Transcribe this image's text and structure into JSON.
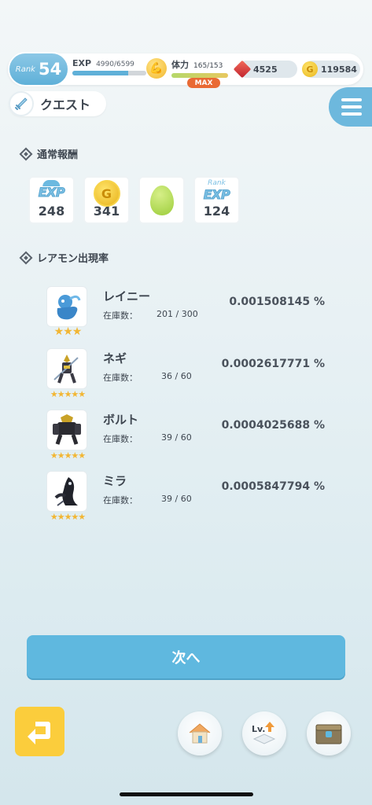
{
  "status": {
    "rank_label": "Rank",
    "rank_value": "54",
    "exp_label": "EXP",
    "exp_value": "4990/6599",
    "exp_progress": 0.756,
    "stamina_label": "体力",
    "stamina_value": "165/153",
    "stamina_progress": 1.0,
    "max_badge": "MAX",
    "gems": "4525",
    "coins": "119584"
  },
  "header": {
    "quest_label": "クエスト"
  },
  "normal_rewards": {
    "title": "通常報酬",
    "items": [
      {
        "icon": "exp-icon",
        "label": "EXP",
        "value": "248"
      },
      {
        "icon": "coin-icon",
        "label": "G",
        "value": "341"
      },
      {
        "icon": "egg-icon",
        "label": "",
        "value": ""
      },
      {
        "icon": "rank-exp-icon",
        "label": "EXP",
        "sublabel": "Rank",
        "value": "124"
      }
    ]
  },
  "rare_monsters": {
    "title": "レアモン出現率",
    "stock_label": "在庫数：",
    "items": [
      {
        "name": "レイニー",
        "stock": "201 / 300",
        "rate": "0.001508145 %",
        "stars": 3,
        "stars_text": "★★★",
        "color": "#4a9ad8"
      },
      {
        "name": "ネギ",
        "stock": "36 / 60",
        "rate": "0.0002617771 %",
        "stars": 5,
        "stars_text": "★★★★★",
        "color": "#3a3a44"
      },
      {
        "name": "ボルト",
        "stock": "39 / 60",
        "rate": "0.0004025688 %",
        "stars": 5,
        "stars_text": "★★★★★",
        "color": "#2a2a30"
      },
      {
        "name": "ミラ",
        "stock": "39 / 60",
        "rate": "0.0005847794 %",
        "stars": 5,
        "stars_text": "★★★★★",
        "color": "#20222a"
      }
    ]
  },
  "buttons": {
    "next_label": "次へ",
    "levelup_text": "Lv."
  },
  "colors": {
    "accent": "#5fb8df",
    "back_button": "#fbcd3c",
    "max_badge": "#e96a34",
    "star": "#f2b633"
  }
}
